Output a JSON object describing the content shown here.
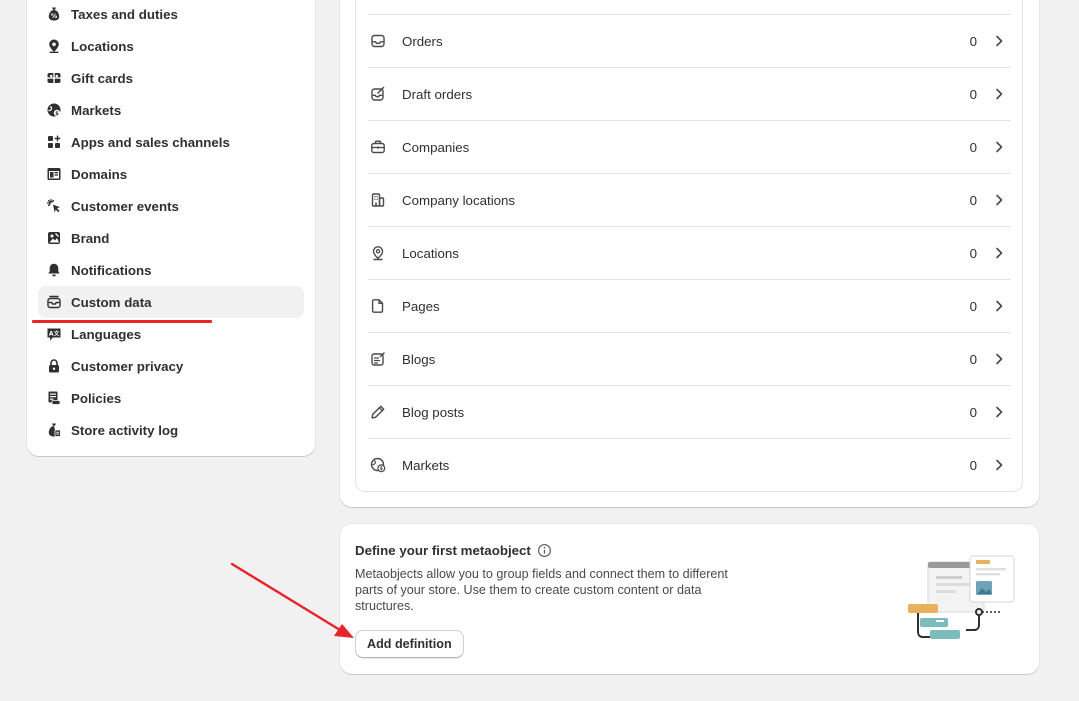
{
  "sidebar": {
    "items": [
      {
        "label": "Taxes and duties",
        "icon": "tax-bag-icon"
      },
      {
        "label": "Locations",
        "icon": "location-pin-icon"
      },
      {
        "label": "Gift cards",
        "icon": "gift-card-icon"
      },
      {
        "label": "Markets",
        "icon": "globe-icon"
      },
      {
        "label": "Apps and sales channels",
        "icon": "apps-icon"
      },
      {
        "label": "Domains",
        "icon": "domain-icon"
      },
      {
        "label": "Customer events",
        "icon": "cursor-click-icon"
      },
      {
        "label": "Brand",
        "icon": "brand-image-icon"
      },
      {
        "label": "Notifications",
        "icon": "bell-icon"
      },
      {
        "label": "Custom data",
        "icon": "custom-data-icon",
        "active": true
      },
      {
        "label": "Languages",
        "icon": "language-icon"
      },
      {
        "label": "Customer privacy",
        "icon": "lock-icon"
      },
      {
        "label": "Policies",
        "icon": "policy-icon"
      },
      {
        "label": "Store activity log",
        "icon": "activity-log-icon"
      }
    ]
  },
  "metafields": {
    "rows": [
      {
        "label": "Orders",
        "count": "0",
        "icon": "inbox-icon"
      },
      {
        "label": "Draft orders",
        "count": "0",
        "icon": "draft-order-icon"
      },
      {
        "label": "Companies",
        "count": "0",
        "icon": "briefcase-icon"
      },
      {
        "label": "Company locations",
        "count": "0",
        "icon": "building-icon"
      },
      {
        "label": "Locations",
        "count": "0",
        "icon": "location-pin-icon"
      },
      {
        "label": "Pages",
        "count": "0",
        "icon": "page-icon"
      },
      {
        "label": "Blogs",
        "count": "0",
        "icon": "blog-icon"
      },
      {
        "label": "Blog posts",
        "count": "0",
        "icon": "pencil-icon"
      },
      {
        "label": "Markets",
        "count": "0",
        "icon": "globe-icon"
      }
    ]
  },
  "metaobject": {
    "title": "Define your first metaobject",
    "description": "Metaobjects allow you to group fields and connect them to different parts of your store. Use them to create custom content or data structures.",
    "button_label": "Add definition"
  },
  "colors": {
    "annotation_red": "#e8242a",
    "page_bg": "#f1f1f1",
    "active_item_bg": "#f1f1f1"
  }
}
